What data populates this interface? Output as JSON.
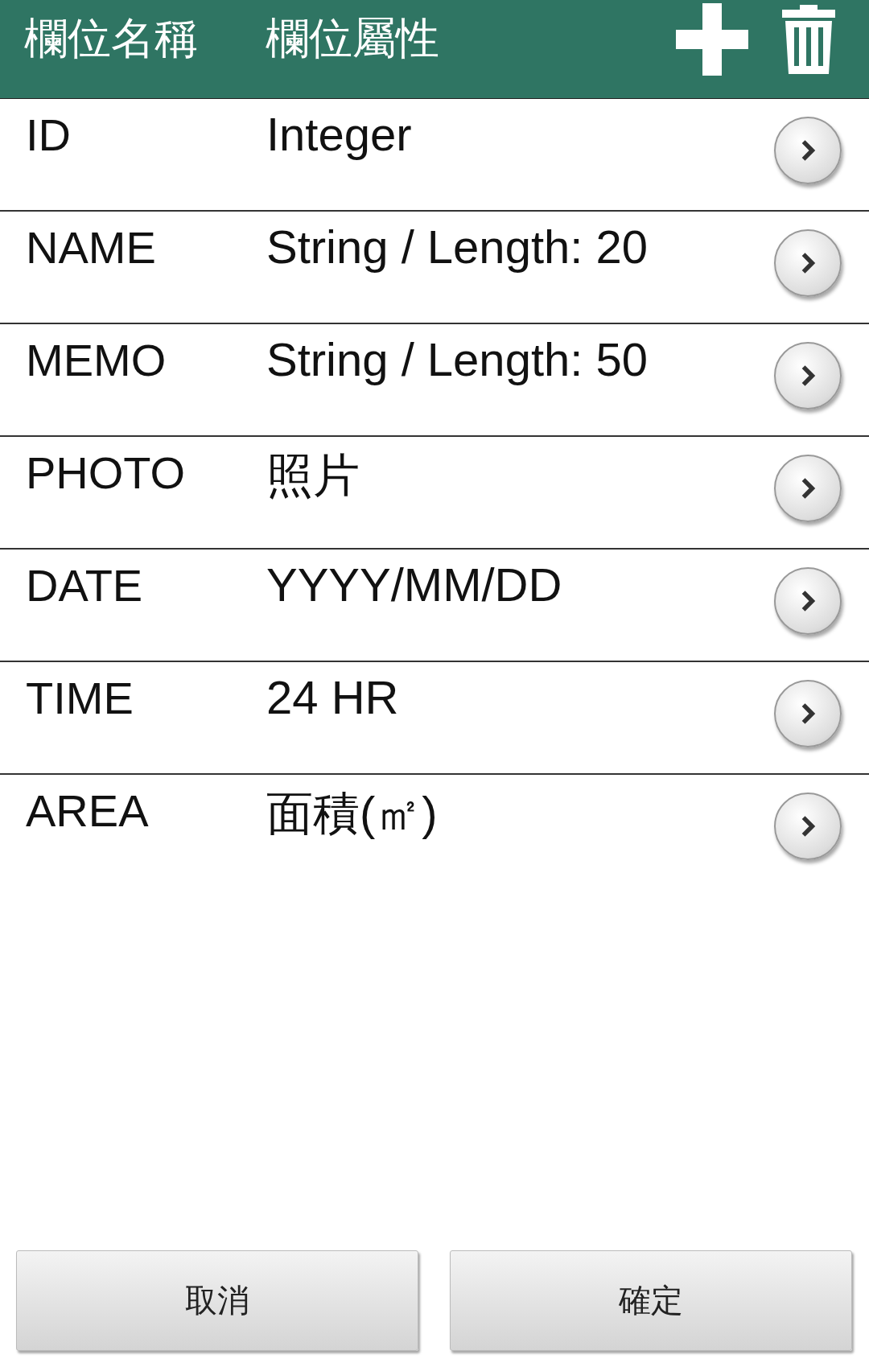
{
  "header": {
    "columns": [
      "欄位名稱",
      "欄位屬性"
    ]
  },
  "fields": [
    {
      "name": "ID",
      "type": "Integer"
    },
    {
      "name": "NAME",
      "type": "String / Length: 20"
    },
    {
      "name": "MEMO",
      "type": "String / Length: 50"
    },
    {
      "name": "PHOTO",
      "type": "照片"
    },
    {
      "name": "DATE",
      "type": "YYYY/MM/DD"
    },
    {
      "name": "TIME",
      "type": "24 HR"
    },
    {
      "name": "AREA",
      "type": "面積(㎡)"
    }
  ],
  "buttons": [
    "取消",
    "確定"
  ]
}
